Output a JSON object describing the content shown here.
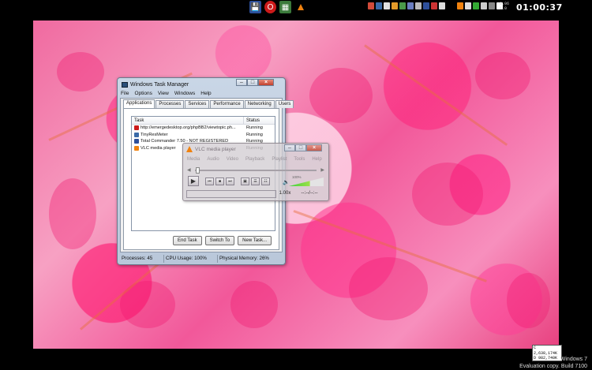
{
  "clock": "01:00:37",
  "tray_mini_text": [
    "0.06",
    "1.0"
  ],
  "watermark": {
    "line1": "Windows 7",
    "line2": "Evaluation copy. Build 7100"
  },
  "memory_box": [
    "C 2,638,174K",
    "D 982,740K",
    "E 2,545,376K"
  ],
  "task_manager": {
    "title": "Windows Task Manager",
    "menu": [
      "File",
      "Options",
      "View",
      "Windows",
      "Help"
    ],
    "tabs": [
      "Applications",
      "Processes",
      "Services",
      "Performance",
      "Networking",
      "Users"
    ],
    "columns": {
      "task": "Task",
      "status": "Status"
    },
    "rows": [
      {
        "task": "http://emergedesktop.org/phpBB2/viewtopic.ph...",
        "status": "Running",
        "icon": "opera-icon",
        "color": "#cc1a1a"
      },
      {
        "task": "TinyResMeter",
        "status": "Running",
        "icon": "monitor-icon",
        "color": "#3a6aa8"
      },
      {
        "task": "Total Commander 7.50 - NOT REGISTERED",
        "status": "Running",
        "icon": "floppy-icon",
        "color": "#2d4f9a"
      },
      {
        "task": "VLC media player",
        "status": "Running",
        "icon": "vlc-cone-icon",
        "color": "#f0820f"
      }
    ],
    "buttons": {
      "end_task": "End Task",
      "switch_to": "Switch To",
      "new_task": "New Task..."
    },
    "status": {
      "processes": "Processes: 45",
      "cpu": "CPU Usage: 100%",
      "memory": "Physical Memory: 26%"
    }
  },
  "vlc": {
    "title": "VLC media player",
    "menu": [
      "Media",
      "Audio",
      "Video",
      "Playback",
      "Playlist",
      "Tools",
      "Help"
    ],
    "volume": "100%",
    "speed": "1.00x",
    "time": "--:--/--:--"
  }
}
